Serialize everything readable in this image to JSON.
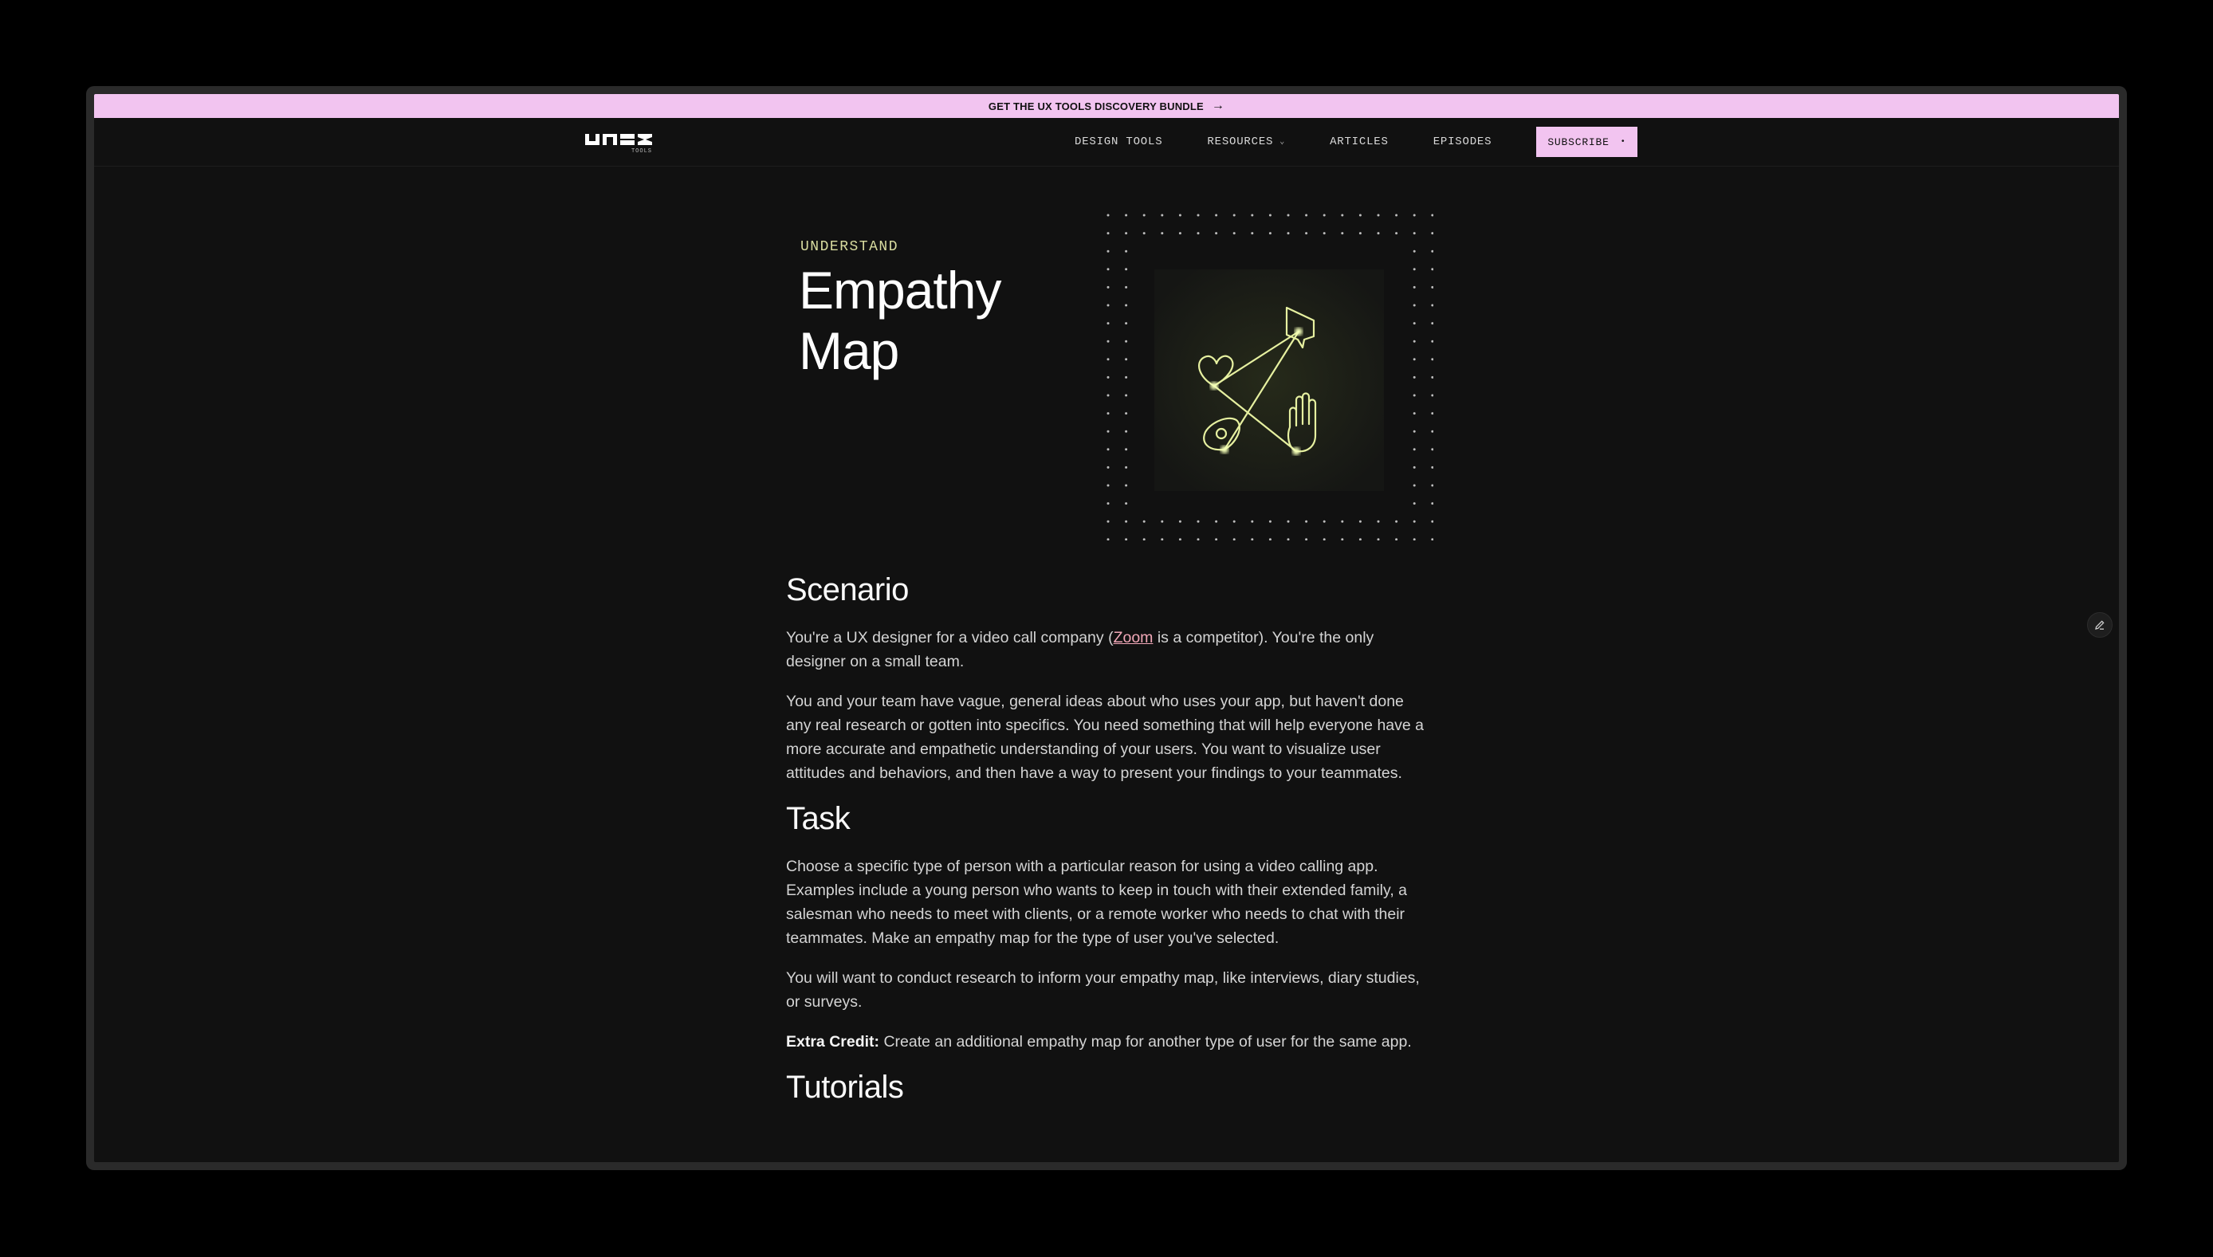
{
  "promo": {
    "text": "GET THE UX TOOLS DISCOVERY BUNDLE",
    "arrow": "→"
  },
  "nav": {
    "items": [
      {
        "label": "DESIGN TOOLS"
      },
      {
        "label": "RESOURCES",
        "chevron": "⌄"
      },
      {
        "label": "ARTICLES"
      },
      {
        "label": "EPISODES"
      }
    ],
    "subscribe": {
      "label": "SUBSCRIBE",
      "dot": "•"
    }
  },
  "hero": {
    "kicker": "UNDERSTAND",
    "title_line1": "Empathy",
    "title_line2": "Map"
  },
  "scenario": {
    "heading": "Scenario",
    "p1_before": "You're a UX designer for a video call company (",
    "p1_link": "Zoom",
    "p1_after": " is a competitor). You're the only designer on a small team.",
    "p2": "You and your team have vague, general ideas about who uses your app, but haven't done any real research or gotten into specifics. You need something that will help everyone have a more accurate and empathetic understanding of your users. You want to visualize user attitudes and behaviors, and then have a way to present your findings to your teammates."
  },
  "task": {
    "heading": "Task",
    "p1": "Choose a specific type of person with a particular reason for using a video calling app. Examples include a young person who wants to keep in touch with their extended family, a salesman who needs to meet with clients, or a remote worker who needs to chat with their teammates. Make an empathy map for the type of user you've selected.",
    "p2": "You will want to conduct research to inform your empathy map, like interviews, diary studies, or surveys.",
    "extra_label": "Extra Credit:",
    "extra_text": " Create an additional empathy map for another type of user for the same app."
  },
  "tutorials": {
    "heading": "Tutorials"
  },
  "colors": {
    "accent": "#f2c4f0",
    "kicker": "#d9dca0",
    "link": "#f2a8b8",
    "background": "#111111"
  },
  "icons": [
    "logo-icon",
    "arrow-right-icon",
    "chevron-down-icon",
    "empathy-map-illustration-icon",
    "pencil-edit-icon"
  ]
}
